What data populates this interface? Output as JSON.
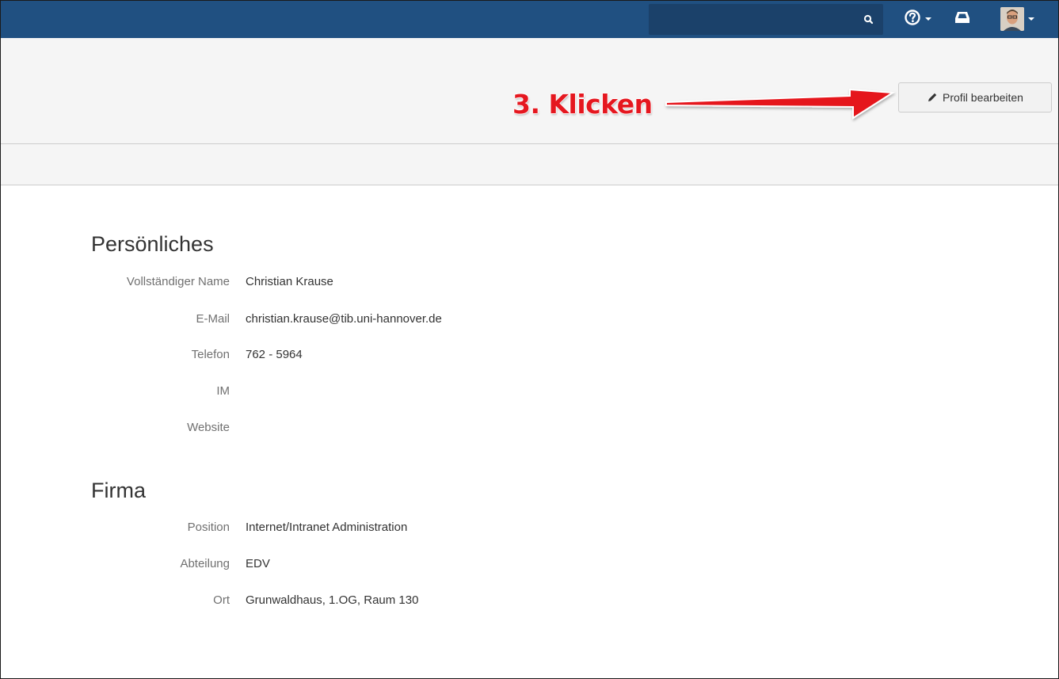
{
  "topbar": {
    "search_value": "",
    "search_icon": "search-icon",
    "help_icon": "help-icon",
    "notifications_icon": "notifications-icon",
    "avatar": "user-avatar",
    "brand_color": "#205081"
  },
  "header": {
    "edit_button_label": "Profil bearbeiten",
    "annotation_text": "3. Klicken",
    "annotation_color": "#e5171f"
  },
  "personal": {
    "title": "Persönliches",
    "fields": [
      {
        "label": "Vollständiger Name",
        "value": "Christian Krause"
      },
      {
        "label": "E-Mail",
        "value": "christian.krause@tib.uni-hannover.de"
      },
      {
        "label": "Telefon",
        "value": "762 - 5964"
      },
      {
        "label": "IM",
        "value": ""
      },
      {
        "label": "Website",
        "value": ""
      }
    ]
  },
  "company": {
    "title": "Firma",
    "fields": [
      {
        "label": "Position",
        "value": "Internet/Intranet Administration"
      },
      {
        "label": "Abteilung",
        "value": "EDV"
      },
      {
        "label": "Ort",
        "value": "Grunwaldhaus, 1.OG, Raum 130"
      }
    ]
  }
}
